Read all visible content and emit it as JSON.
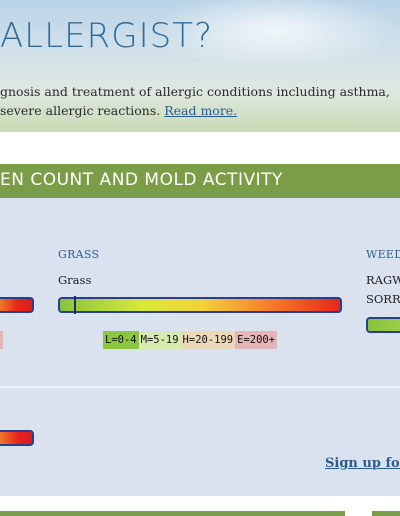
{
  "hero": {
    "title": "ALLERGIST?",
    "line1": "gnosis and treatment of allergic conditions including asthma,",
    "line2": " severe allergic reactions.",
    "read_more": "Read more."
  },
  "section": {
    "title": "EN COUNT AND MOLD ACTIVITY"
  },
  "columns": {
    "grass": {
      "heading": "GRASS",
      "label": "Grass",
      "level": 0.05
    },
    "weeds": {
      "heading": "WEED",
      "label_1": "RAGW",
      "label_2": "SORRE"
    }
  },
  "legend": {
    "low": "L=0-4",
    "medium": "M=5-19",
    "high": "H=20-199",
    "extreme": "E=200+"
  },
  "signup": {
    "label": "Sign up for"
  },
  "colors": {
    "accent_green": "#7c9d47",
    "title_blue": "#2f6c9a",
    "link_blue": "#2b5d8e",
    "panel_bg": "#dae2ef",
    "bar_border": "#2a3f8c"
  }
}
